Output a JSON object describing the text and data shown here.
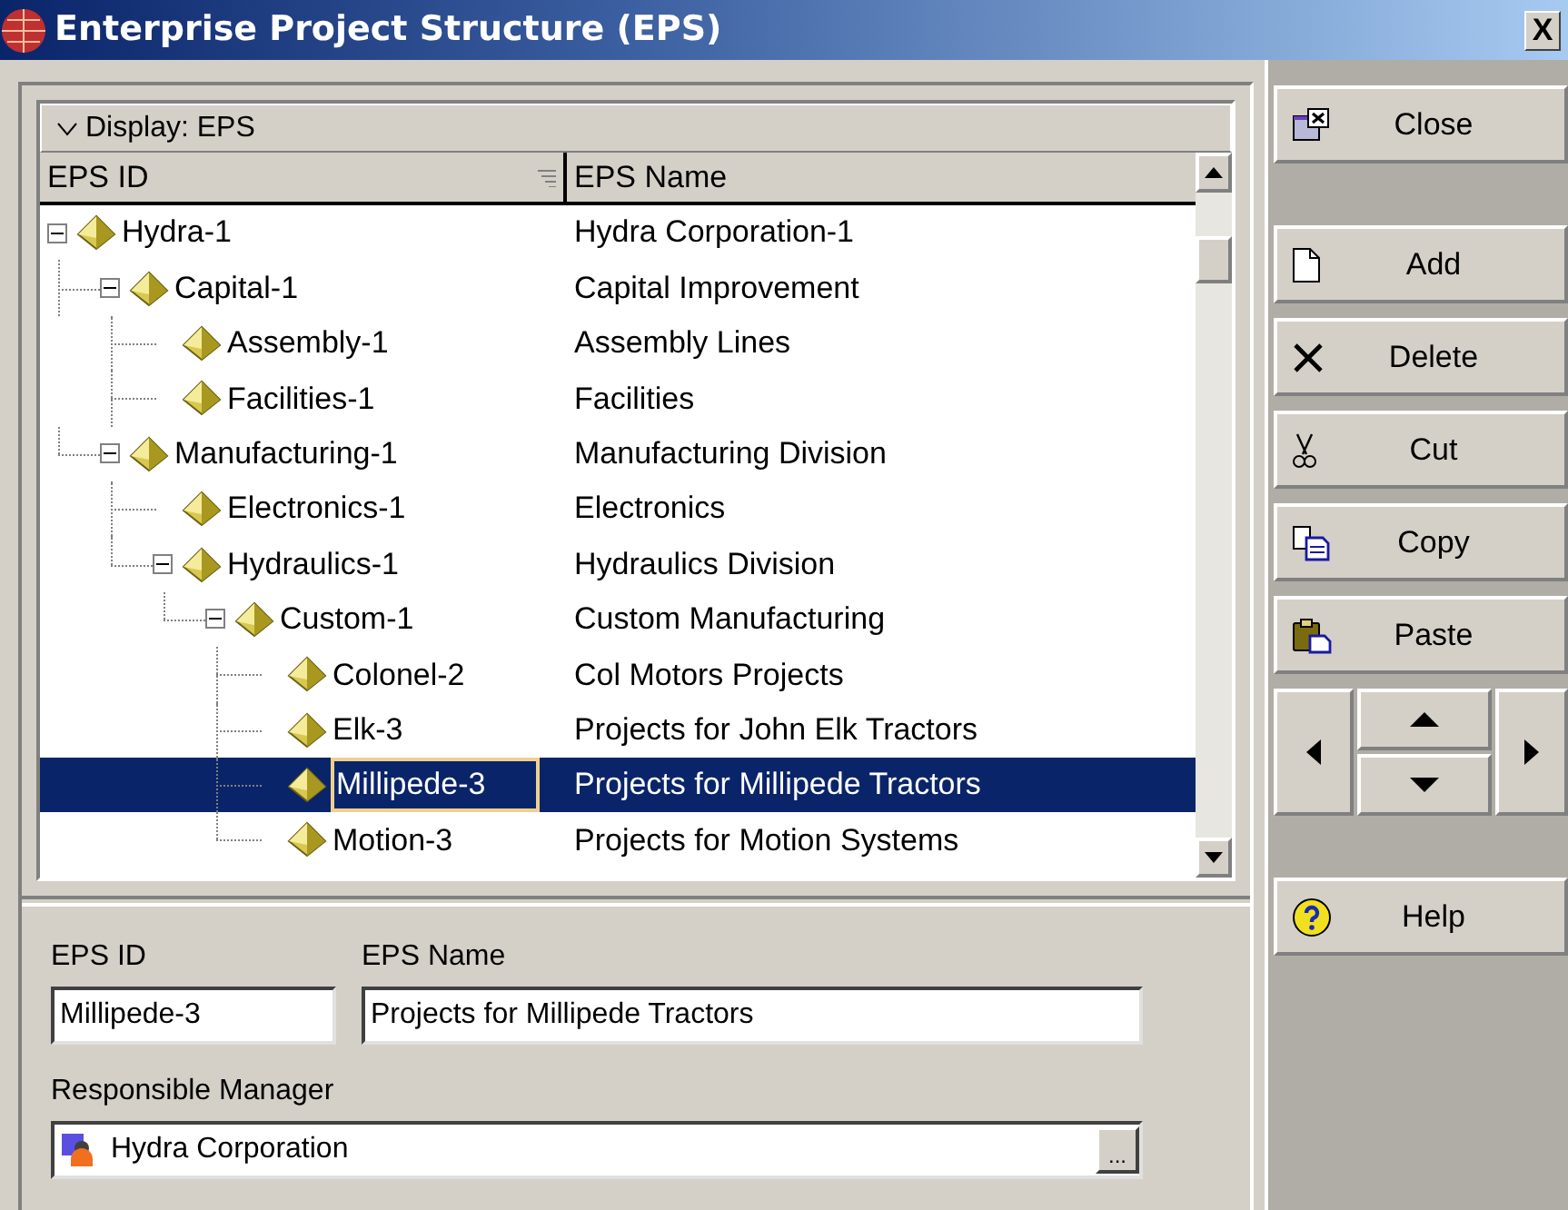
{
  "window": {
    "title": "Enterprise Project Structure (EPS)",
    "close_glyph": "X"
  },
  "display_bar": {
    "label": "Display: EPS"
  },
  "table": {
    "columns": [
      "EPS ID",
      "EPS Name"
    ],
    "rows": [
      {
        "id": "Hydra-1",
        "name": "Hydra Corporation-1",
        "expanded": true,
        "selected": false,
        "children": [
          {
            "id": "Capital-1",
            "name": "Capital Improvement",
            "expanded": true,
            "selected": false,
            "children": [
              {
                "id": "Assembly-1",
                "name": "Assembly Lines",
                "selected": false
              },
              {
                "id": "Facilities-1",
                "name": "Facilities",
                "selected": false
              }
            ]
          },
          {
            "id": "Manufacturing-1",
            "name": "Manufacturing Division",
            "expanded": true,
            "selected": false,
            "children": [
              {
                "id": "Electronics-1",
                "name": "Electronics",
                "selected": false
              },
              {
                "id": "Hydraulics-1",
                "name": "Hydraulics Division",
                "expanded": true,
                "selected": false,
                "children": [
                  {
                    "id": "Custom-1",
                    "name": "Custom Manufacturing",
                    "expanded": true,
                    "selected": false,
                    "children": [
                      {
                        "id": "Colonel-2",
                        "name": "Col Motors Projects",
                        "selected": false
                      },
                      {
                        "id": "Elk-3",
                        "name": "Projects for John Elk Tractors",
                        "selected": false
                      },
                      {
                        "id": "Millipede-3",
                        "name": "Projects for Millipede Tractors",
                        "selected": true
                      },
                      {
                        "id": "Motion-3",
                        "name": "Projects for Motion Systems",
                        "selected": false
                      }
                    ]
                  }
                ]
              }
            ]
          }
        ]
      }
    ]
  },
  "details": {
    "eps_id": {
      "label": "EPS ID",
      "value": "Millipede-3"
    },
    "eps_name": {
      "label": "EPS Name",
      "value": "Projects for Millipede Tractors"
    },
    "manager": {
      "label": "Responsible Manager",
      "value": "Hydra Corporation",
      "browse": "..."
    }
  },
  "buttons": [
    {
      "kind": "close",
      "label": "Close"
    },
    {
      "kind": "gap"
    },
    {
      "kind": "add",
      "label": "Add"
    },
    {
      "kind": "delete",
      "label": "Delete"
    },
    {
      "kind": "cut",
      "label": "Cut"
    },
    {
      "kind": "copy",
      "label": "Copy"
    },
    {
      "kind": "paste",
      "label": "Paste"
    },
    {
      "kind": "arrows"
    },
    {
      "kind": "gap"
    },
    {
      "kind": "help",
      "label": "Help"
    }
  ]
}
